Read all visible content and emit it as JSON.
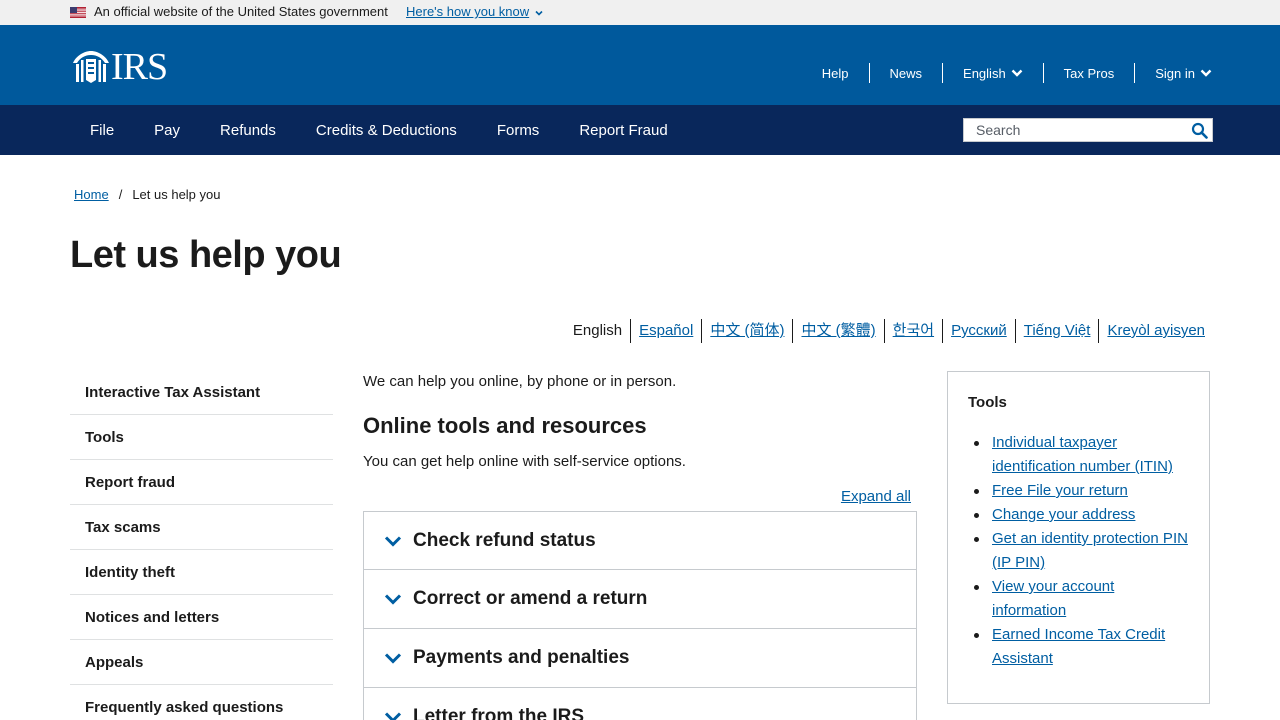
{
  "gov_banner": {
    "text": "An official website of the United States government",
    "link": "Here's how you know"
  },
  "header": {
    "logo_text": "IRS",
    "utility": [
      {
        "label": "Help"
      },
      {
        "label": "News"
      },
      {
        "label": "English"
      },
      {
        "label": "Tax Pros"
      },
      {
        "label": "Sign in"
      }
    ]
  },
  "nav": {
    "items": [
      "File",
      "Pay",
      "Refunds",
      "Credits & Deductions",
      "Forms",
      "Report Fraud"
    ],
    "search_placeholder": "Search"
  },
  "breadcrumb": {
    "home": "Home",
    "separator": "/",
    "current": "Let us help you"
  },
  "page_title": "Let us help you",
  "languages": [
    "English",
    "Español",
    "中文 (简体)",
    "中文 (繁體)",
    "한국어",
    "Русский",
    "Tiếng Việt",
    "Kreyòl ayisyen"
  ],
  "sidebar": {
    "items": [
      "Interactive Tax Assistant",
      "Tools",
      "Report fraud",
      "Tax scams",
      "Identity theft",
      "Notices and letters",
      "Appeals",
      "Frequently asked questions"
    ]
  },
  "main": {
    "intro": "We can help you online, by phone or in person.",
    "section_title": "Online tools and resources",
    "section_text": "You can get help online with self-service options.",
    "expand_all": "Expand all",
    "accordion": [
      "Check refund status",
      "Correct or amend a return",
      "Payments and penalties",
      "Letter from the IRS"
    ]
  },
  "tools": {
    "title": "Tools",
    "links": [
      "Individual taxpayer identification number (ITIN)",
      "Free File your return",
      "Change your address",
      "Get an identity protection PIN (IP PIN)",
      "View your account information",
      "Earned Income Tax Credit Assistant"
    ]
  },
  "colors": {
    "header_blue": "#00599c",
    "nav_navy": "#09275b",
    "link_blue": "#005ea2",
    "accordion_chevron": "#005ea2"
  }
}
